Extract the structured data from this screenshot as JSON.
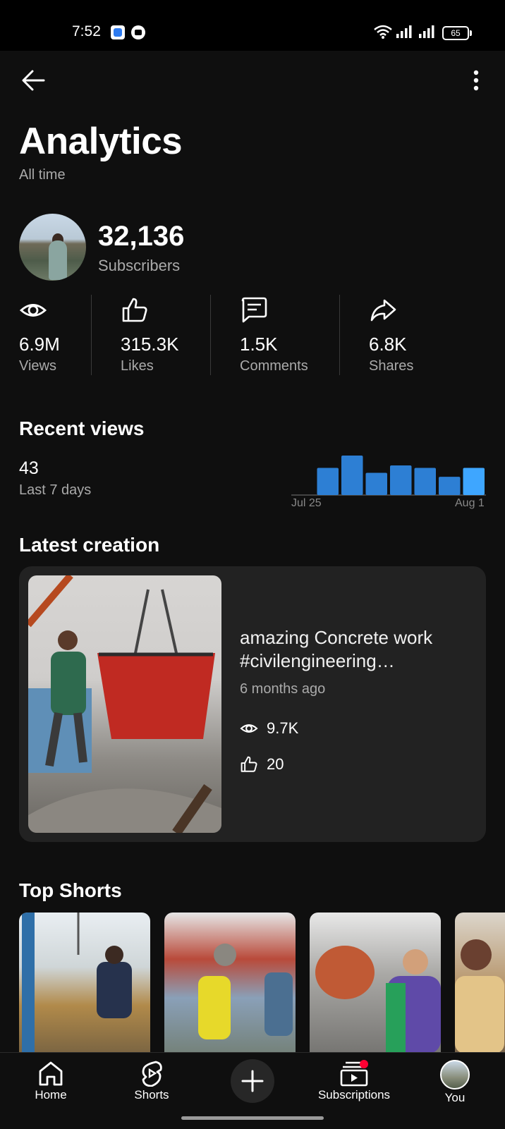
{
  "status_bar": {
    "time": "7:52",
    "battery": "65"
  },
  "header": {
    "title": "Analytics",
    "subtitle": "All time"
  },
  "channel": {
    "subscribers_value": "32,136",
    "subscribers_label": "Subscribers"
  },
  "stats": [
    {
      "icon": "eye-icon",
      "value": "6.9M",
      "label": "Views"
    },
    {
      "icon": "thumbs-up-icon",
      "value": "315.3K",
      "label": "Likes"
    },
    {
      "icon": "comment-icon",
      "value": "1.5K",
      "label": "Comments"
    },
    {
      "icon": "share-icon",
      "value": "6.8K",
      "label": "Shares"
    }
  ],
  "recent_views": {
    "heading": "Recent views",
    "value": "43",
    "period": "Last 7 days"
  },
  "chart_data": {
    "type": "bar",
    "x_start_label": "Jul 25",
    "x_end_label": "Aug 1",
    "values": [
      0,
      5.5,
      8,
      4.5,
      6,
      5.5,
      3.7,
      5.5
    ],
    "ylim": [
      0,
      8
    ],
    "color": "#2d7fd4",
    "highlight_color": "#3ea6ff",
    "grid": false
  },
  "latest_creation": {
    "heading": "Latest creation",
    "title": "amazing Concrete work #civilengineering #construction",
    "age": "6 months ago",
    "views": "9.7K",
    "likes": "20"
  },
  "top_shorts": {
    "heading": "Top Shorts"
  },
  "nav": {
    "home": "Home",
    "shorts": "Shorts",
    "subscriptions": "Subscriptions",
    "you": "You"
  },
  "colors": {
    "background": "#0f0f0f",
    "card": "#222222",
    "accent": "#3ea6ff",
    "notification": "#ff0033"
  }
}
